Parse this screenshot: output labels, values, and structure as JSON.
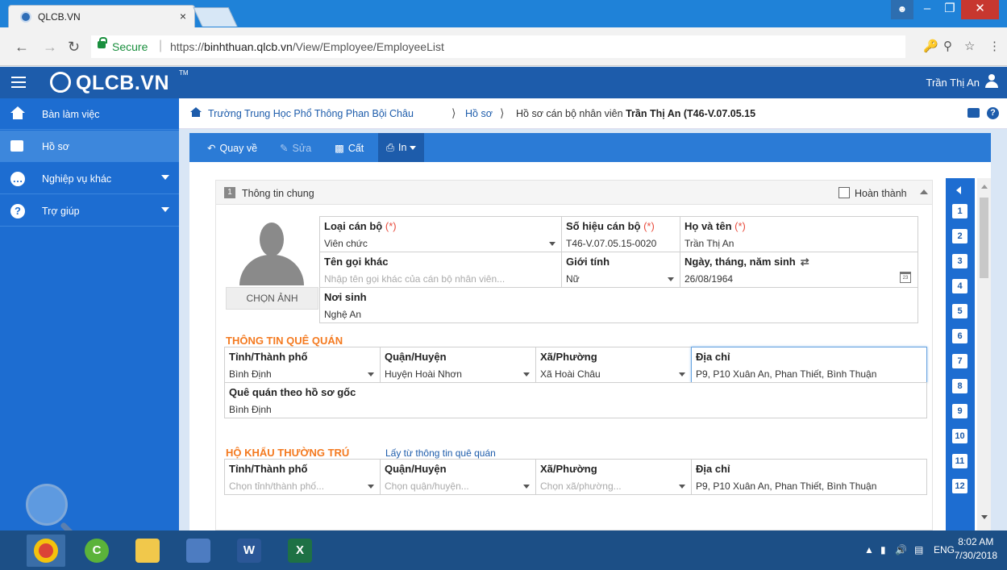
{
  "browser": {
    "tab_title": "QLCB.VN",
    "tab_close": "×",
    "secure_label": "Secure",
    "url_prefix": "https://",
    "url_host": "binhthuan.qlcb.vn",
    "url_path": "/View/Employee/EmployeeList"
  },
  "app": {
    "logo_text": "QLCB.VN",
    "logo_tm": "TM",
    "user_name": "Trần Thị An"
  },
  "sidebar": {
    "items": [
      {
        "label": "Bàn làm việc",
        "icon": "home-icon"
      },
      {
        "label": "Hồ sơ",
        "icon": "profile-icon"
      },
      {
        "label": "Nghiệp vụ khác",
        "icon": "more-icon"
      },
      {
        "label": "Trợ giúp",
        "icon": "help-icon"
      }
    ]
  },
  "breadcrumb": {
    "school": "Trường Trung Học Phổ Thông Phan Bội Châu",
    "section": "Hồ sơ",
    "current_prefix": "Hồ sơ cán bộ nhân viên",
    "current_name": "Trần Thị An (T46-V.07.05.15"
  },
  "toolbar": {
    "back": "Quay về",
    "edit": "Sửa",
    "save": "Cất",
    "print": "In"
  },
  "section1": {
    "number": "1",
    "title": "Thông tin chung",
    "complete_label": "Hoàn thành",
    "choose_photo": "CHỌN ẢNH",
    "fields": {
      "staff_type": {
        "label": "Loại cán bộ",
        "required": "(*)",
        "value": "Viên chức"
      },
      "staff_code": {
        "label": "Số hiệu cán bộ",
        "required": "(*)",
        "value": "T46-V.07.05.15-0020"
      },
      "full_name": {
        "label": "Họ và tên",
        "required": "(*)",
        "value": "Trần Thị An"
      },
      "alias": {
        "label": "Tên gọi khác",
        "placeholder": "Nhập tên gọi khác của cán bộ nhân viên..."
      },
      "gender": {
        "label": "Giới tính",
        "value": "Nữ"
      },
      "dob": {
        "label": "Ngày, tháng, năm sinh",
        "value": "26/08/1964"
      },
      "birthplace": {
        "label": "Nơi sinh",
        "value": "Nghệ An"
      }
    }
  },
  "hometown": {
    "title": "THÔNG TIN QUÊ QUÁN",
    "province": {
      "label": "Tỉnh/Thành phố",
      "value": "Bình Định"
    },
    "district": {
      "label": "Quận/Huyện",
      "value": "Huyện Hoài Nhơn"
    },
    "ward": {
      "label": "Xã/Phường",
      "value": "Xã Hoài Châu"
    },
    "address": {
      "label": "Địa chỉ",
      "value": "P9, P10 Xuân An, Phan Thiết, Bình Thuận"
    },
    "original": {
      "label": "Quê quán theo hồ sơ gốc",
      "value": "Bình Định"
    }
  },
  "residence": {
    "title": "HỘ KHẨU THƯỜNG TRÚ",
    "copy_link": "Lấy từ thông tin quê quán",
    "province": {
      "label": "Tỉnh/Thành phố",
      "placeholder": "Chọn tỉnh/thành phố..."
    },
    "district": {
      "label": "Quận/Huyện",
      "placeholder": "Chọn quận/huyện..."
    },
    "ward": {
      "label": "Xã/Phường",
      "placeholder": "Chọn xã/phường..."
    },
    "address": {
      "label": "Địa chỉ",
      "value": "P9, P10 Xuân An, Phan Thiết, Bình Thuận"
    }
  },
  "section_nav": [
    "1",
    "2",
    "3",
    "4",
    "5",
    "6",
    "7",
    "8",
    "9",
    "10",
    "11",
    "12"
  ],
  "taskbar": {
    "lang": "ENG",
    "time": "8:02 AM",
    "date": "7/30/2018"
  },
  "colors": {
    "brand": "#1d5cab",
    "accent_orange": "#f47a20",
    "required_red": "#e84c3d"
  }
}
